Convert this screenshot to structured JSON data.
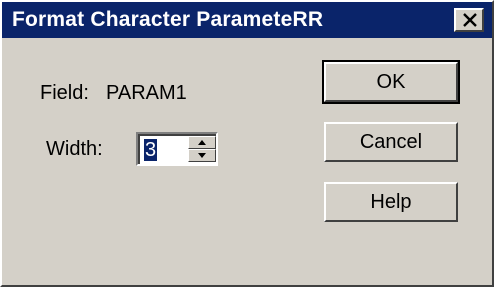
{
  "window": {
    "title": "Format Character ParameteRR"
  },
  "form": {
    "field_label": "Field:",
    "field_value": "PARAM1",
    "width_label": "Width:",
    "width_value": "3"
  },
  "buttons": {
    "ok": "OK",
    "cancel": "Cancel",
    "help": "Help"
  },
  "icons": {
    "close": "close-icon",
    "spin_up": "up-arrow-icon",
    "spin_down": "down-arrow-icon"
  },
  "colors": {
    "titlebar": "#0a246a",
    "face": "#d4d0c8",
    "selection": "#0a246a"
  }
}
